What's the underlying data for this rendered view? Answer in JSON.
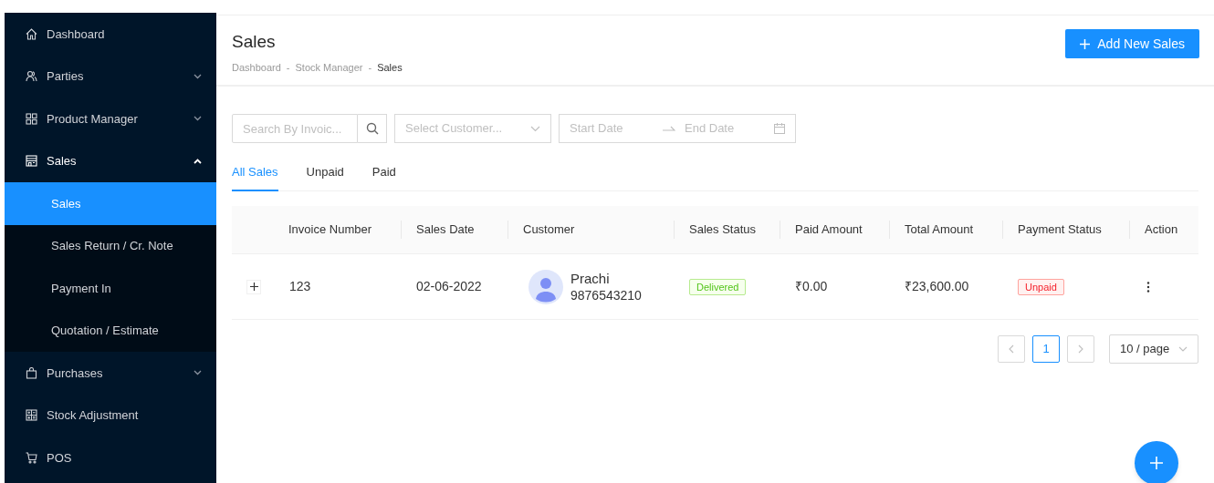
{
  "sidebar": {
    "items": [
      {
        "label": "Dashboard",
        "has_submenu": false,
        "expanded": false,
        "selected": false
      },
      {
        "label": "Parties",
        "has_submenu": true,
        "expanded": false,
        "selected": false
      },
      {
        "label": "Product Manager",
        "has_submenu": true,
        "expanded": false,
        "selected": false
      },
      {
        "label": "Sales",
        "has_submenu": true,
        "expanded": true,
        "selected": false,
        "children": [
          {
            "label": "Sales",
            "selected": true
          },
          {
            "label": "Sales Return / Cr. Note",
            "selected": false
          },
          {
            "label": "Payment In",
            "selected": false
          },
          {
            "label": "Quotation / Estimate",
            "selected": false
          }
        ]
      },
      {
        "label": "Purchases",
        "has_submenu": true,
        "expanded": false,
        "selected": false
      },
      {
        "label": "Stock Adjustment",
        "has_submenu": false,
        "expanded": false,
        "selected": false
      },
      {
        "label": "POS",
        "has_submenu": false,
        "expanded": false,
        "selected": false
      }
    ]
  },
  "header": {
    "title": "Sales",
    "breadcrumb": [
      "Dashboard",
      "Stock Manager",
      "Sales"
    ],
    "separator": "-",
    "add_button": "Add New Sales"
  },
  "filters": {
    "search": {
      "placeholder": "Search By Invoic..."
    },
    "customer": {
      "placeholder": "Select Customer..."
    },
    "start_date": {
      "placeholder": "Start Date"
    },
    "end_date": {
      "placeholder": "End Date"
    }
  },
  "tabs": [
    {
      "label": "All Sales",
      "selected": true
    },
    {
      "label": "Unpaid",
      "selected": false
    },
    {
      "label": "Paid",
      "selected": false
    }
  ],
  "table": {
    "columns": [
      "Invoice Number",
      "Sales Date",
      "Customer",
      "Sales Status",
      "Paid Amount",
      "Total Amount",
      "Payment Status",
      "Action"
    ],
    "rows": [
      {
        "expanded": false,
        "invoice": "123",
        "date": "02-06-2022",
        "customer_name": "Prachi",
        "customer_phone": "9876543210",
        "sales_status": {
          "label": "Delivered",
          "kind": "success"
        },
        "paid": "₹0.00",
        "total": "₹23,600.00",
        "payment_status": {
          "label": "Unpaid",
          "kind": "error"
        }
      }
    ]
  },
  "pagination": {
    "prev_disabled": true,
    "next_disabled": true,
    "pages": [
      {
        "label": "1",
        "selected": true
      }
    ],
    "page_size": "10 / page"
  }
}
